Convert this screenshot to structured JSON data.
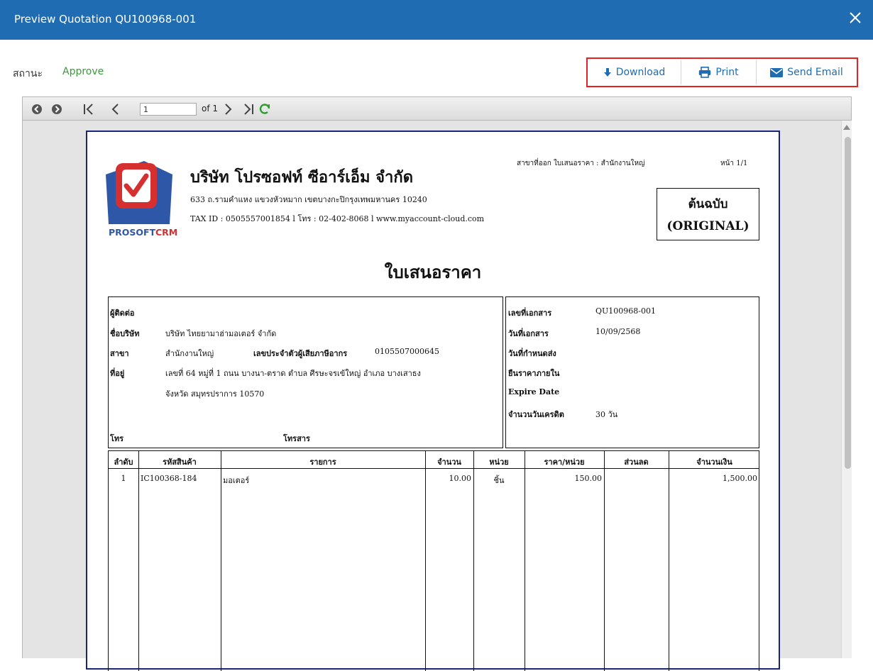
{
  "window": {
    "title": "Preview Quotation QU100968-001"
  },
  "status": {
    "label": "สถานะ",
    "value": "Approve"
  },
  "actions": {
    "download": "Download",
    "print": "Print",
    "send_email": "Send Email"
  },
  "toolbar": {
    "page_value": "1",
    "page_of": "of 1"
  },
  "document": {
    "branch_line": "สาขาที่ออก ใบเสนอราคา : สำนักงานใหญ่",
    "page_no": "หน้า 1/1",
    "company_name": "บริษัท โปรซอฟท์ ซีอาร์เอ็ม จำกัด",
    "company_address": "633 ถ.รามคำแหง แขวงหัวหมาก เขตบางกะปิกรุงเทพมหานคร 10240",
    "company_tax": "TAX ID : 0505557001854 l โทร : 02-402-8068 l www.myaccount-cloud.com",
    "logo_text_a": "PROSOFT",
    "logo_text_b": "CRM",
    "original_th": "ต้นฉบับ",
    "original_en": "(ORIGINAL)",
    "title": "ใบเสนอราคา",
    "customer": {
      "contact_label": "ผู้ติดต่อ",
      "company_label": "ชื่อบริษัท",
      "company_value": "บริษัท ไทยยามาฮ่ามอเตอร์ จำกัด",
      "branch_label": "สาขา",
      "branch_value": "สำนักงานใหญ่",
      "taxid_label": "เลขประจำตัวผู้เสียภาษีอากร",
      "taxid_value": "0105507000645",
      "address_label": "ที่อยู่",
      "address_line1": "เลขที่ 64 หมู่ที่ 1 ถนน บางนา-ตราด ตำบล ศีรษะจรเข้ใหญ่ อำเภอ บางเสาธง",
      "address_line2": "จังหวัด สมุทรปราการ 10570",
      "phone_label": "โทร",
      "fax_label": "โทรสาร"
    },
    "info": {
      "doc_no_label": "เลขที่เอกสาร",
      "doc_no_value": "QU100968-001",
      "doc_date_label": "วันที่เอกสาร",
      "doc_date_value": "10/09/2568",
      "delivery_label": "วันที่กำหนดส่ง",
      "valid_label": "ยืนราคาภายใน",
      "expire_label": "Expire Date",
      "credit_label": "จำนวนวันเครดิต",
      "credit_value": "30 วัน"
    },
    "table": {
      "headers": [
        "ลำดับ",
        "รหัสสินค้า",
        "รายการ",
        "จำนวน",
        "หน่วย",
        "ราคา/หน่วย",
        "ส่วนลด",
        "จำนวนเงิน"
      ],
      "rows": [
        [
          "1",
          "IC100368-184",
          "มอเตอร์",
          "10.00",
          "ชิ้น",
          "150.00",
          "",
          "1,500.00"
        ]
      ]
    }
  },
  "colors": {
    "header": "#1f6cb2",
    "status": "#3a9a3a",
    "highlight": "#e02424"
  }
}
